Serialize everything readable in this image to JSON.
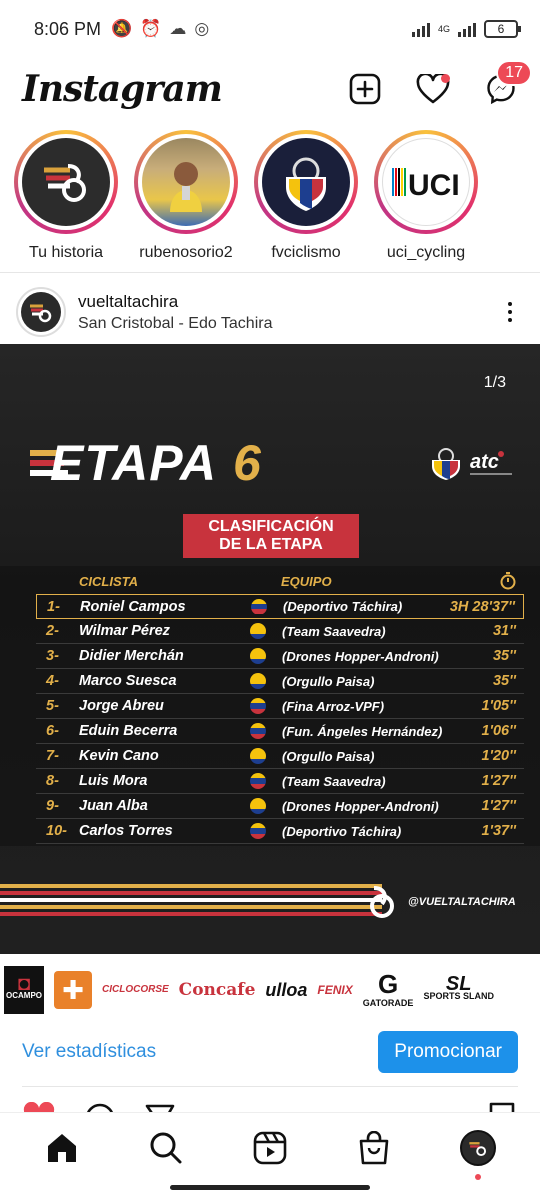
{
  "status_bar": {
    "time": "8:06 PM",
    "network": "4G",
    "battery": "6"
  },
  "app": {
    "title": "Instagram",
    "messages_badge": "17"
  },
  "stories": [
    {
      "name": "Tu historia"
    },
    {
      "name": "rubenosorio2"
    },
    {
      "name": "fvciclismo"
    },
    {
      "name": "uci_cycling"
    }
  ],
  "post": {
    "username": "vueltaltachira",
    "location": "San Cristobal - Edo Tachira",
    "counter": "1/3",
    "title_word": "ETAPA",
    "title_number": "6",
    "badge_line1": "CLASIFICACIÓN",
    "badge_line2": "DE LA ETAPA",
    "col_rider": "CICLISTA",
    "col_team": "EQUIPO",
    "handle": "@VUELTALTACHIRA",
    "rows": [
      {
        "pos": "1-",
        "name": "Roniel Campos",
        "team": "(Deportivo Táchira)",
        "time": "3H 28'37''",
        "flag": "ven"
      },
      {
        "pos": "2-",
        "name": "Wilmar Pérez",
        "team": "(Team Saavedra)",
        "time": "31''",
        "flag": "col"
      },
      {
        "pos": "3-",
        "name": "Didier Merchán",
        "team": "(Drones Hopper-Androni)",
        "time": "35''",
        "flag": "col"
      },
      {
        "pos": "4-",
        "name": "Marco Suesca",
        "team": "(Orgullo Paisa)",
        "time": "35''",
        "flag": "col"
      },
      {
        "pos": "5-",
        "name": "Jorge Abreu",
        "team": "(Fina Arroz-VPF)",
        "time": "1'05''",
        "flag": "ven"
      },
      {
        "pos": "6-",
        "name": "Eduin Becerra",
        "team": "(Fun. Ángeles Hernández)",
        "time": "1'06''",
        "flag": "ven"
      },
      {
        "pos": "7-",
        "name": "Kevin Cano",
        "team": "(Orgullo Paisa)",
        "time": "1'20''",
        "flag": "col"
      },
      {
        "pos": "8-",
        "name": "Luis Mora",
        "team": "(Team Saavedra)",
        "time": "1'27''",
        "flag": "ven"
      },
      {
        "pos": "9-",
        "name": "Juan Alba",
        "team": "(Drones Hopper-Androni)",
        "time": "1'27''",
        "flag": "col"
      },
      {
        "pos": "10-",
        "name": "Carlos Torres",
        "team": "(Deportivo Táchira)",
        "time": "1'37''",
        "flag": "ven"
      }
    ]
  },
  "sponsors": [
    "OCAMPO",
    "CICLOCORSE",
    "Concafe",
    "ulloa",
    "FENIX",
    "GATORADE",
    "SPORTS SLAND"
  ],
  "actions": {
    "stats_link": "Ver estadísticas",
    "promote_button": "Promocionar"
  },
  "colors": {
    "accent_blue": "#1d91ea",
    "link_blue": "#2f8fde",
    "notification_red": "#ed4956",
    "gold": "#e2b04a",
    "badge_red": "#c8333d"
  }
}
